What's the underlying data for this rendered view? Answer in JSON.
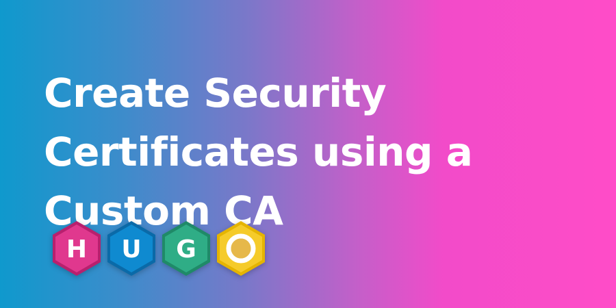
{
  "title": {
    "line1": "Create Security",
    "line2": "Certificates using a",
    "line3": "Custom CA"
  },
  "logo": {
    "letters": [
      "H",
      "U",
      "G",
      "O"
    ],
    "colors": {
      "h": "#e0388e",
      "h_border": "#b8206e",
      "u": "#0f8ad0",
      "u_border": "#0a6aa8",
      "g": "#2fad86",
      "g_border": "#1f8a68",
      "o": "#f5cb2a",
      "o_border": "#e5b400",
      "o_inner": "#e6b84a"
    }
  }
}
